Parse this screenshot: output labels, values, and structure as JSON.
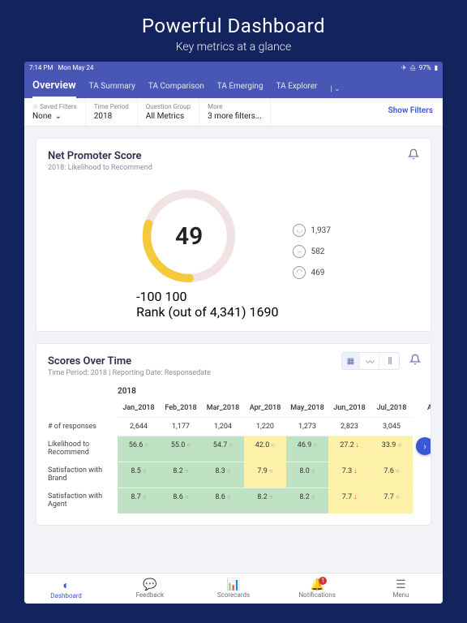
{
  "hero": {
    "title": "Powerful Dashboard",
    "subtitle": "Key metrics at a glance"
  },
  "statusbar": {
    "time": "7:14 PM",
    "date": "Mon May 24",
    "battery": "97%"
  },
  "nav": {
    "tabs": [
      "Overview",
      "TA Summary",
      "TA Comparison",
      "TA Emerging",
      "TA Explorer"
    ]
  },
  "filters": {
    "saved_label": "Saved Filters",
    "saved_value": "None",
    "period_label": "Time Period",
    "period_value": "2018",
    "qgroup_label": "Question Group",
    "qgroup_value": "All Metrics",
    "more_label": "More",
    "more_value": "3 more filters...",
    "show": "Show Filters"
  },
  "nps": {
    "title": "Net Promoter Score",
    "subtitle": "2018: Likelihood to Recommend",
    "score": "49",
    "min": "-100",
    "max": "100",
    "rank": "Rank (out of 4,341) 1690",
    "happy": "1,937",
    "neutral": "582",
    "sad": "469"
  },
  "sot": {
    "title": "Scores Over Time",
    "subtitle": "Time Period: 2018 | Reporting Date: Responsedate",
    "year": "2018",
    "cols": [
      "Jan_2018",
      "Feb_2018",
      "Mar_2018",
      "Apr_2018",
      "May_2018",
      "Jun_2018",
      "Jul_2018",
      "Aug"
    ],
    "row_resp_label": "# of responses",
    "responses": [
      "2,644",
      "1,177",
      "1,204",
      "1,220",
      "1,273",
      "2,823",
      "3,045"
    ],
    "metrics": [
      {
        "label": "Likelihood to Recommend",
        "cells": [
          {
            "v": "56.6",
            "c": "g",
            "t": "o"
          },
          {
            "v": "55.0",
            "c": "g",
            "t": "o"
          },
          {
            "v": "54.7",
            "c": "g",
            "t": "o"
          },
          {
            "v": "42.0",
            "c": "y",
            "t": "o"
          },
          {
            "v": "46.9",
            "c": "g",
            "t": "o"
          },
          {
            "v": "27.2",
            "c": "y",
            "t": "d"
          },
          {
            "v": "33.9",
            "c": "y",
            "t": "o"
          }
        ]
      },
      {
        "label": "Satisfaction with Brand",
        "cells": [
          {
            "v": "8.5",
            "c": "g",
            "t": "o"
          },
          {
            "v": "8.2",
            "c": "g",
            "t": "o"
          },
          {
            "v": "8.3",
            "c": "g",
            "t": "o"
          },
          {
            "v": "7.9",
            "c": "y",
            "t": "o"
          },
          {
            "v": "8.0",
            "c": "g",
            "t": "o"
          },
          {
            "v": "7.3",
            "c": "y",
            "t": "d"
          },
          {
            "v": "7.6",
            "c": "y",
            "t": "o"
          }
        ]
      },
      {
        "label": "Satisfaction with Agent",
        "cells": [
          {
            "v": "8.7",
            "c": "g",
            "t": "o"
          },
          {
            "v": "8.6",
            "c": "g",
            "t": "o"
          },
          {
            "v": "8.6",
            "c": "g",
            "t": "o"
          },
          {
            "v": "8.2",
            "c": "g",
            "t": "o"
          },
          {
            "v": "8.2",
            "c": "g",
            "t": "o"
          },
          {
            "v": "7.7",
            "c": "y",
            "t": "d"
          },
          {
            "v": "7.7",
            "c": "y",
            "t": "o"
          }
        ]
      }
    ]
  },
  "tabbar": {
    "items": [
      {
        "label": "Dashboard",
        "icon": "◐"
      },
      {
        "label": "Feedback",
        "icon": "💬"
      },
      {
        "label": "Scorecards",
        "icon": "📊"
      },
      {
        "label": "Notifications",
        "icon": "🔔",
        "badge": "1"
      },
      {
        "label": "Menu",
        "icon": "☰"
      }
    ]
  }
}
